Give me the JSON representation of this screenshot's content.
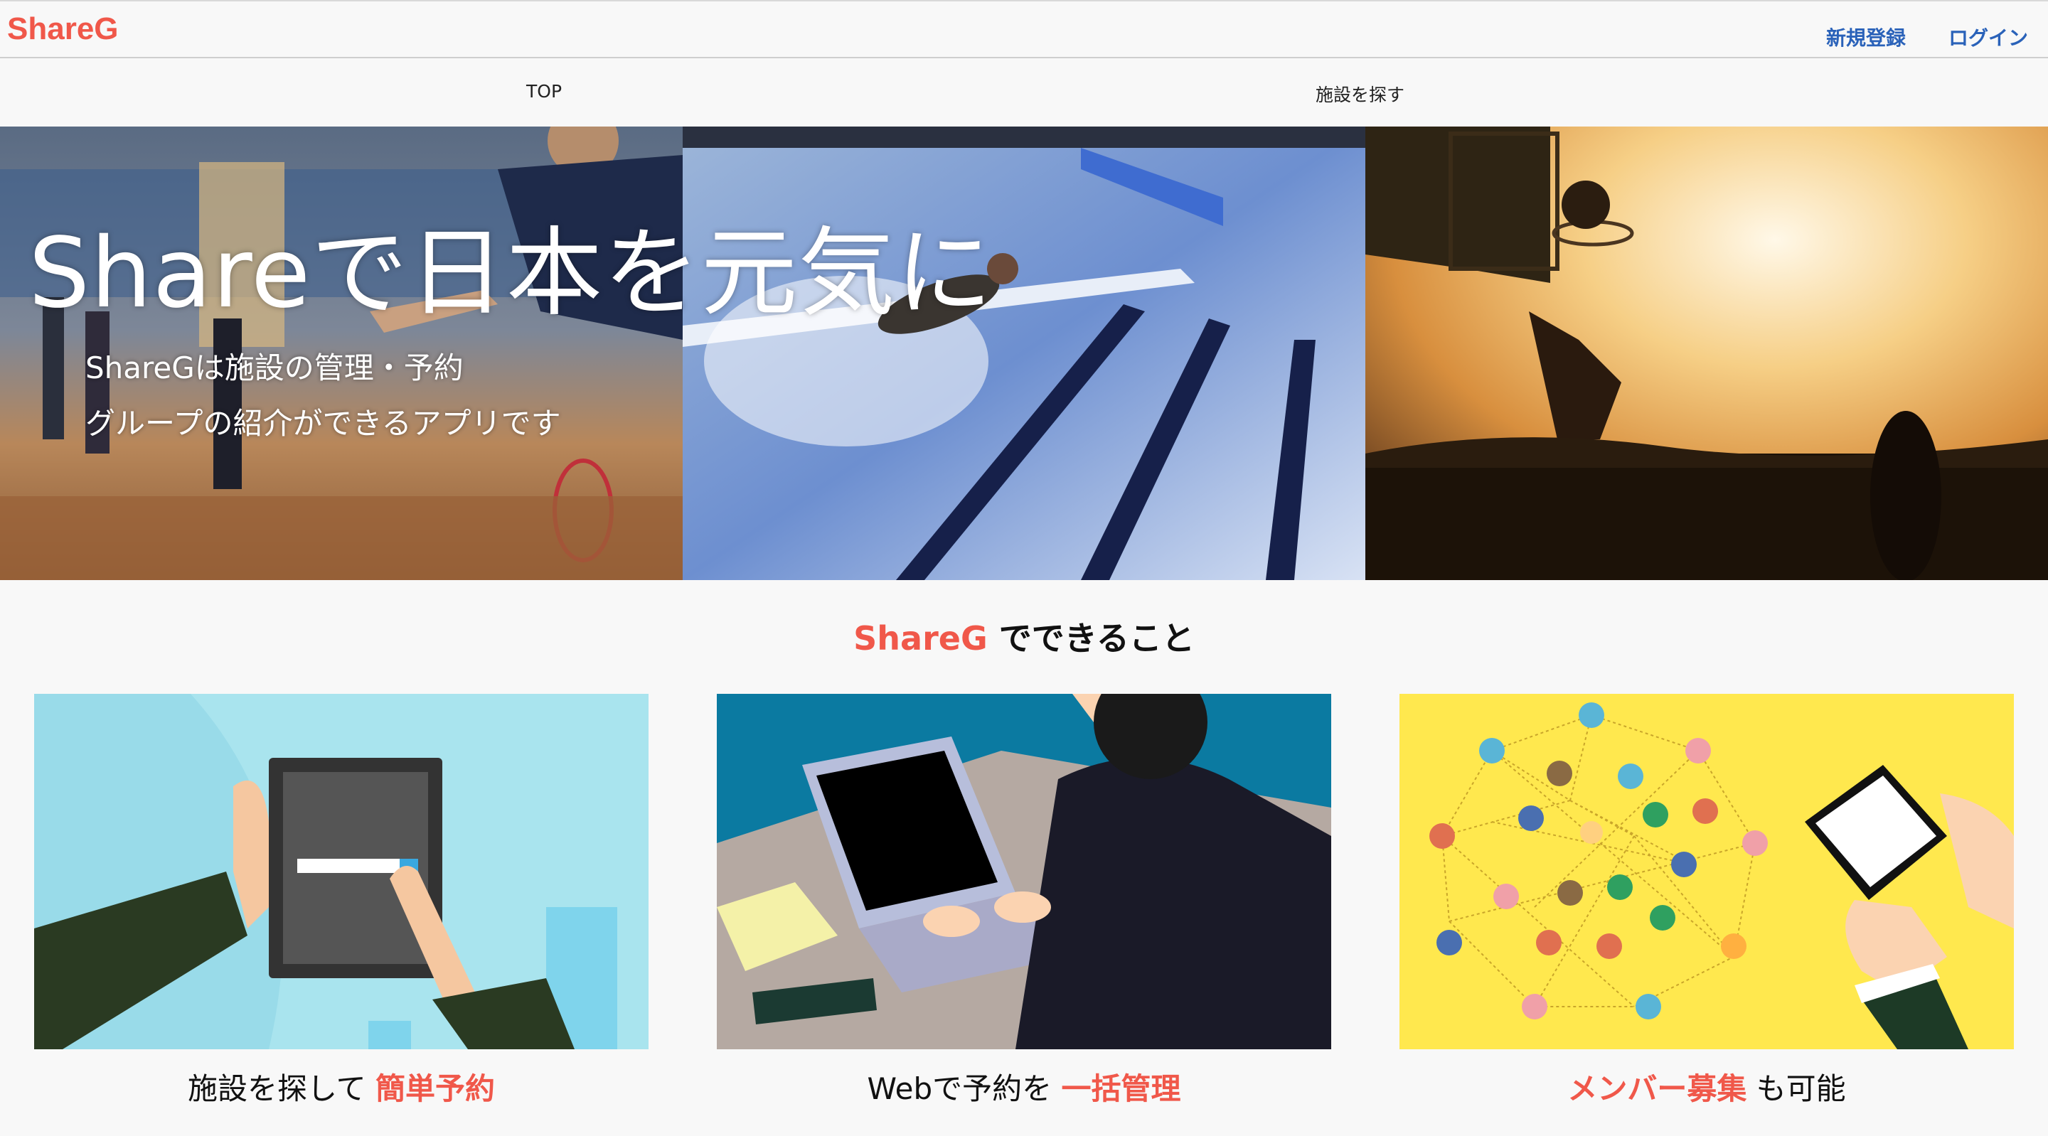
{
  "header": {
    "logo": "ShareG",
    "signup_label": "新規登録",
    "login_label": "ログイン"
  },
  "nav": {
    "items": [
      {
        "label": "TOP"
      },
      {
        "label": "施設を探す"
      }
    ]
  },
  "hero": {
    "title": "Shareで日本を元気に",
    "subtitle_lines": [
      "ShareGは施設の管理・予約",
      "グループの紹介ができるアプリです"
    ]
  },
  "features": {
    "heading_accent": "ShareG",
    "heading_rest": " でできること",
    "cards": [
      {
        "caption_pre": "施設を探して ",
        "caption_accent": "簡単予約",
        "caption_post": ""
      },
      {
        "caption_pre": "Webで予約を ",
        "caption_accent": "一括管理",
        "caption_post": ""
      },
      {
        "caption_pre": "",
        "caption_accent": "メンバー募集",
        "caption_post": " も可能"
      }
    ]
  },
  "colors": {
    "brand": "#f0584a",
    "link": "#2a62b9"
  }
}
